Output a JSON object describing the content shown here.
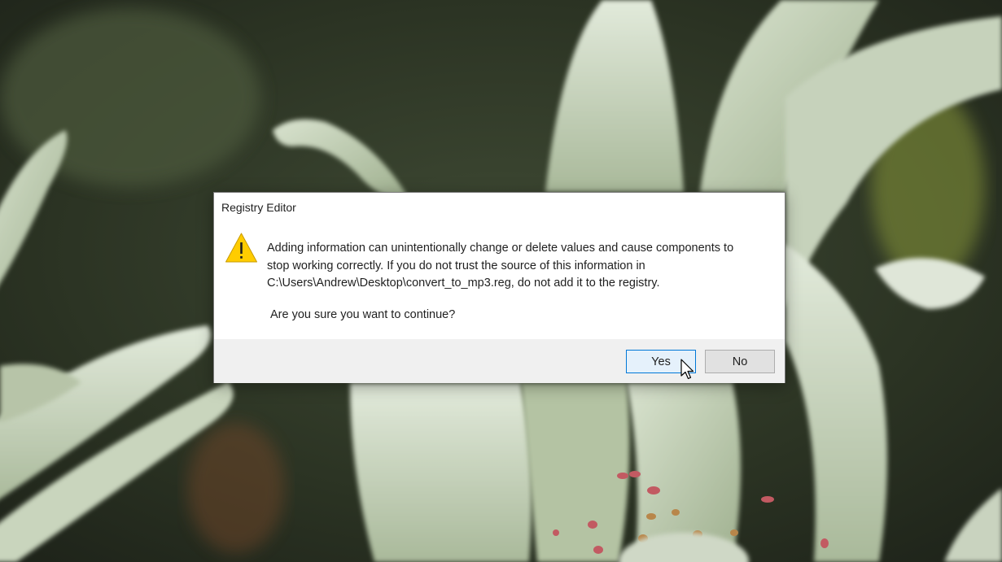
{
  "dialog": {
    "title": "Registry Editor",
    "icon": "warning-icon",
    "message_lines": [
      "Adding information can unintentionally change or delete values and cause components to",
      "stop working correctly. If you do not trust the source of this information in",
      "C:\\Users\\Andrew\\Desktop\\convert_to_mp3.reg, do not add it to the registry."
    ],
    "question": "Are you sure you want to continue?",
    "buttons": {
      "yes_label": "Yes",
      "no_label": "No"
    },
    "focused_button": "Yes"
  },
  "colors": {
    "focus_border": "#0078d7",
    "warning_fill": "#ffcc00",
    "button_bar": "#f0f0f0"
  }
}
